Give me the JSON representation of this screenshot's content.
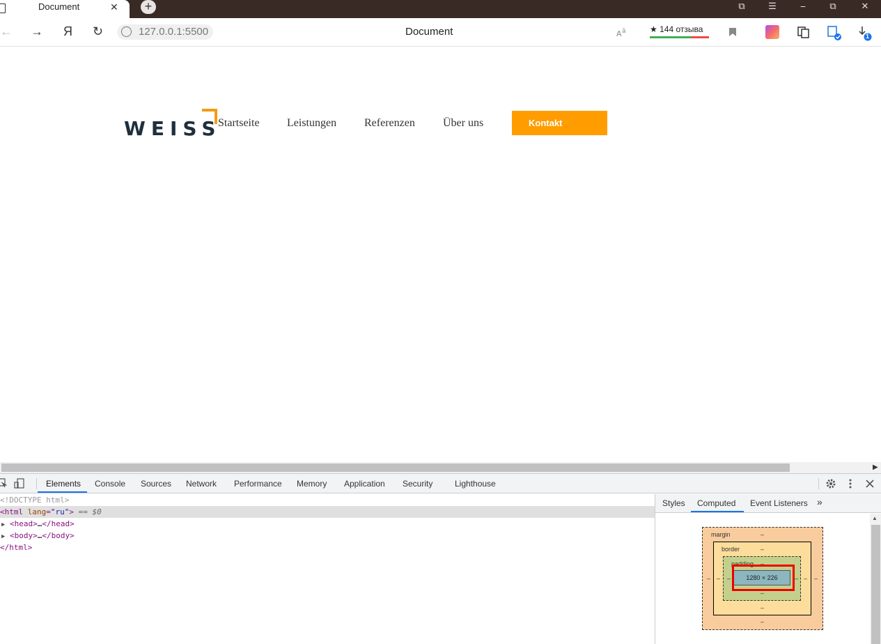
{
  "browser": {
    "tab_title": "Document",
    "tab_close": "✕",
    "new_tab": "+",
    "window_controls": {
      "minimize": "⎯",
      "maximize": "⧉",
      "close": "✕",
      "tabs": "⧉",
      "menu": "☰"
    },
    "nav": {
      "back": "←",
      "forward": "→",
      "yandex": "Я",
      "reload": "↻"
    },
    "url": "127.0.0.1:5500",
    "page_title": "Document",
    "reviews": "★ 144 отзыва",
    "badges": {
      "downloads_count": "1"
    }
  },
  "site": {
    "logo_text": "WEISS",
    "nav_items": [
      "Startseite",
      "Leistungen",
      "Referenzen",
      "Über uns"
    ],
    "cta_label": "Kontakt",
    "colors": {
      "accent": "#ff9d00",
      "logo": "#1f2f3d"
    }
  },
  "devtools": {
    "tabs": [
      "Elements",
      "Console",
      "Sources",
      "Network",
      "Performance",
      "Memory",
      "Application",
      "Security",
      "Lighthouse"
    ],
    "active_tab": "Elements",
    "dom": {
      "doctype": "<!DOCTYPE html>",
      "html_open_tag": "html",
      "html_attr_name": "lang",
      "html_attr_value": "\"ru\"",
      "selected_marker": "== $0",
      "head": "head",
      "body": "body",
      "ellipsis": "…",
      "html_close": "</html>"
    },
    "side_tabs": [
      "Styles",
      "Computed",
      "Event Listeners"
    ],
    "side_active": "Computed",
    "more": "»",
    "box_model": {
      "margin_label": "margin",
      "border_label": "border",
      "padding_label": "padding",
      "content_size": "1280 × 226",
      "dash": "–"
    }
  }
}
